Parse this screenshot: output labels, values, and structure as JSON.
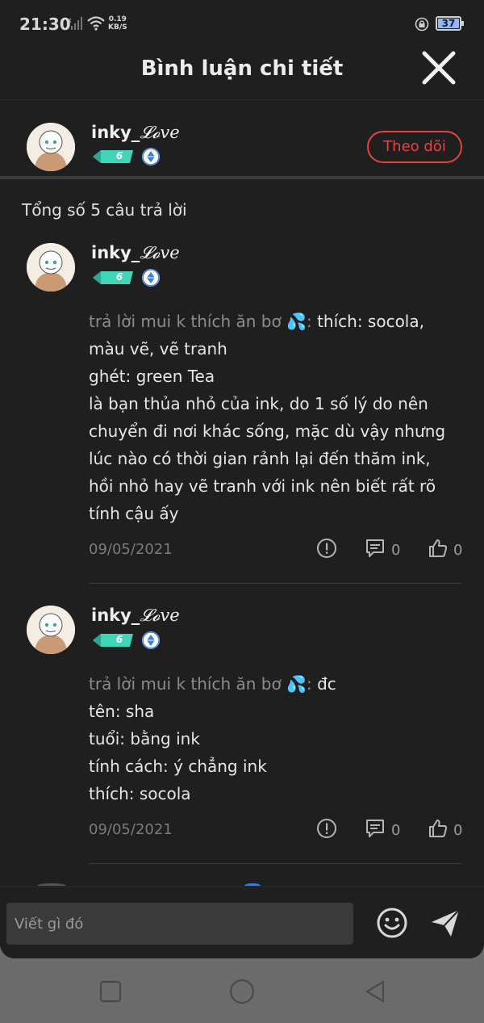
{
  "status_bar": {
    "time": "21:30",
    "net_speed_value": "0.19",
    "net_speed_unit": "KB/S",
    "battery": "37"
  },
  "header": {
    "title": "Bình luận chi tiết",
    "close_icon": "close-icon"
  },
  "post_author": {
    "name_prefix": "inky_",
    "name_script": "𝓛𝓸ve",
    "level": "6",
    "follow_label": "Theo dõi"
  },
  "replies_summary": "Tổng số 5 câu trả lời",
  "replies": [
    {
      "name_prefix": "inky_",
      "name_script": "𝓛𝓸ve",
      "level": "6",
      "reply_to": "trả lời mui k thích ăn bơ 💦:",
      "body_lines": [
        "thích: socola,",
        "màu vẽ, vẽ tranh",
        "ghét: green Tea",
        "là bạn thủa nhỏ của ink, do 1 số lý do nên",
        "chuyển đi nơi khác sống, mặc dù vậy nhưng",
        "lúc nào có thời gian rảnh lại đến thăm ink,",
        "hồi nhỏ hay vẽ tranh với ink nên biết rất rõ",
        "tính cậu ấy"
      ],
      "date": "09/05/2021",
      "comment_count": "0",
      "like_count": "0"
    },
    {
      "name_prefix": "inky_",
      "name_script": "𝓛𝓸ve",
      "level": "6",
      "reply_to": "trả lời mui k thích ăn bơ 💦:",
      "body_lines": [
        "đc",
        "tên: sha",
        "tuổi: bằng ink",
        "tính cách: ý chẳng ink",
        "thích: socola"
      ],
      "date": "09/05/2021",
      "comment_count": "0",
      "like_count": "0"
    }
  ],
  "composer": {
    "placeholder": "Viết gì đó"
  },
  "colors": {
    "background": "#1f1f1f",
    "accent_red": "#e54343",
    "level_teal": "#3fd6b8",
    "badge_blue": "#3b7dd8"
  }
}
